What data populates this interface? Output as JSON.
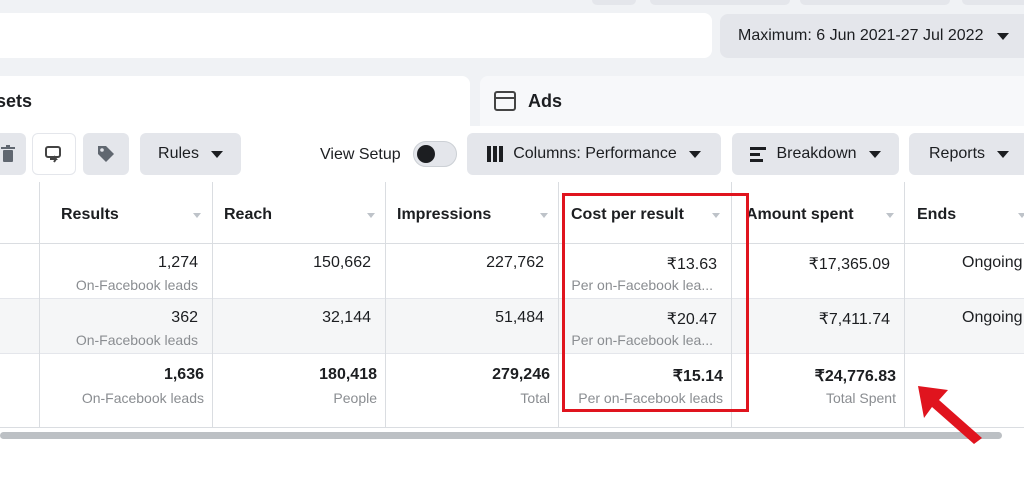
{
  "date_range": {
    "label": "Maximum: 6 Jun 2021-27 Jul 2022"
  },
  "tabs": {
    "adsets_label": "sets",
    "ads_label": "Ads"
  },
  "toolbar": {
    "rules_label": "Rules",
    "view_setup_label": "View Setup",
    "columns_label": "Columns: Performance",
    "breakdown_label": "Breakdown",
    "reports_label": "Reports"
  },
  "table": {
    "headers": [
      "Results",
      "Reach",
      "Impressions",
      "Cost per result",
      "Amount spent",
      "Ends"
    ],
    "rows": [
      {
        "results": "1,274",
        "results_sub": "On-Facebook leads",
        "reach": "150,662",
        "impressions": "227,762",
        "cost": "₹13.63",
        "cost_sub": "Per on-Facebook lea...",
        "spent": "₹17,365.09",
        "ends": "Ongoing"
      },
      {
        "results": "362",
        "results_sub": "On-Facebook leads",
        "reach": "32,144",
        "impressions": "51,484",
        "cost": "₹20.47",
        "cost_sub": "Per on-Facebook lea...",
        "spent": "₹7,411.74",
        "ends": "Ongoing"
      }
    ],
    "total": {
      "results": "1,636",
      "results_sub": "On-Facebook leads",
      "reach": "180,418",
      "reach_sub": "People",
      "impressions": "279,246",
      "impressions_sub": "Total",
      "cost": "₹15.14",
      "cost_sub": "Per on-Facebook leads",
      "spent": "₹24,776.83",
      "spent_sub": "Total Spent"
    }
  },
  "colors": {
    "highlight": "#e0141e",
    "toolbar_button": "#e4e6eb",
    "page_bg": "#f0f2f5"
  },
  "icons": [
    "trash-icon",
    "duplicate-icon",
    "tag-icon",
    "columns-icon",
    "breakdown-icon",
    "ads-frame-icon",
    "red-arrow-annotation"
  ]
}
